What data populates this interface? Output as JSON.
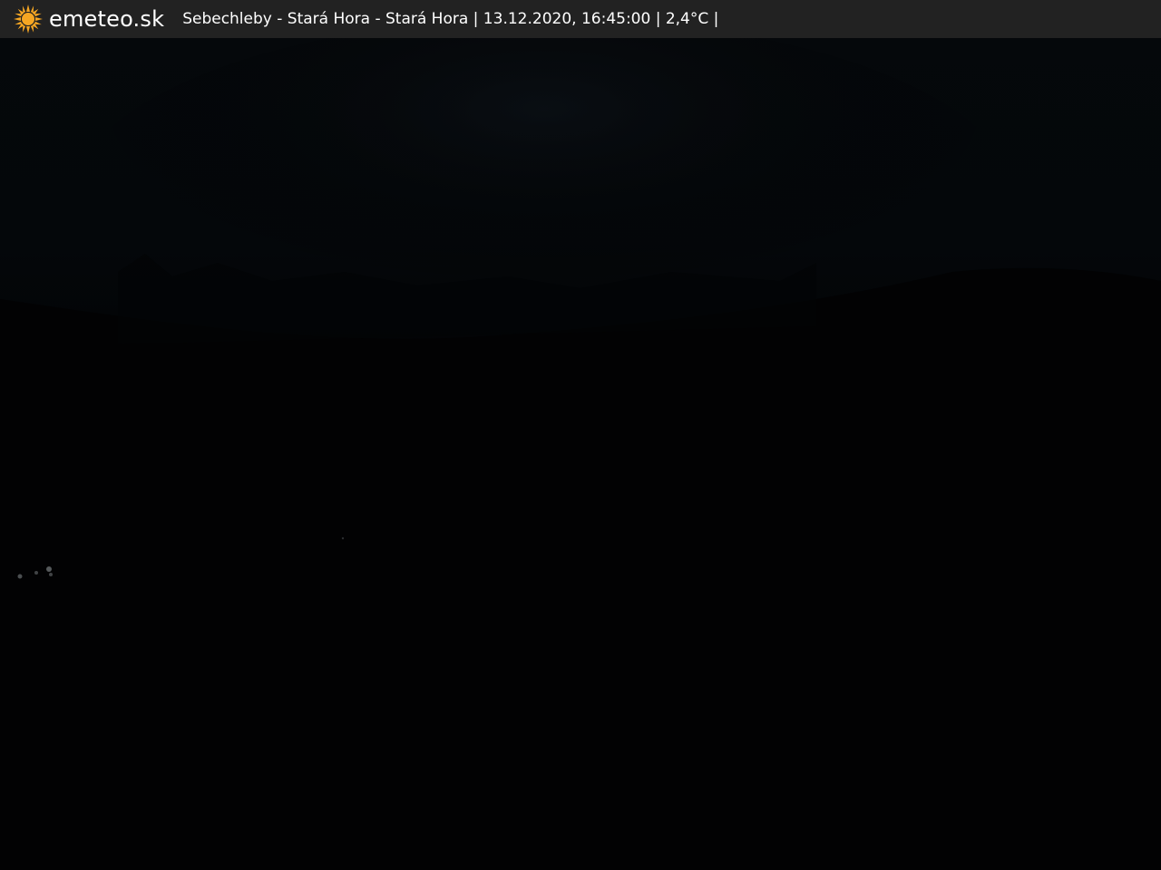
{
  "overlay": {
    "brand": "emeteo.sk",
    "caption": "Sebechleby - Stará Hora - Stará Hora | 13.12.2020, 16:45:00 | 2,4°C |",
    "logo_icon": "sun-icon",
    "bar_color": "#222222",
    "logo_color": "#f5a623"
  },
  "image": {
    "description_name": "night-webcam-view"
  }
}
